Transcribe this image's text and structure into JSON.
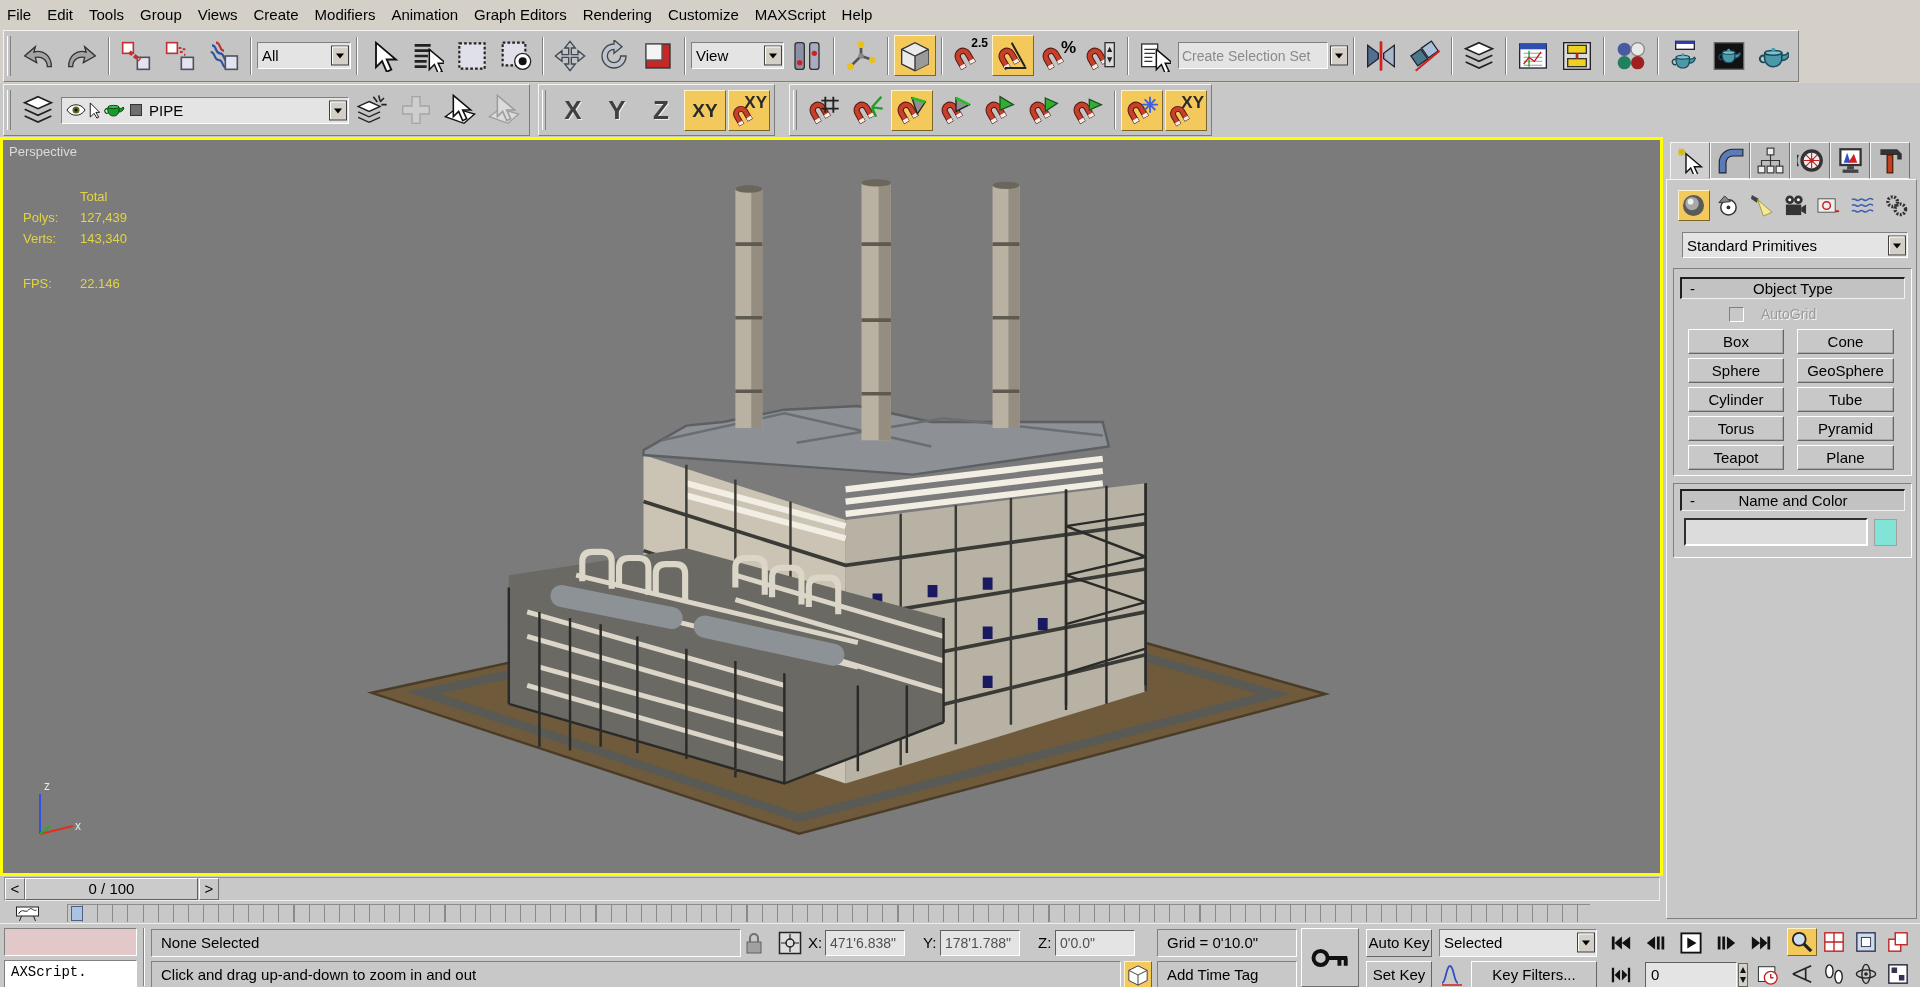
{
  "menu_bar": [
    "File",
    "Edit",
    "Tools",
    "Group",
    "Views",
    "Create",
    "Modifiers",
    "Animation",
    "Graph Editors",
    "Rendering",
    "Customize",
    "MAXScript",
    "Help"
  ],
  "main_toolbar": {
    "groups": [
      [
        {
          "kind": "button",
          "active": false
        },
        {
          "kind": "button",
          "active": false
        }
      ],
      [
        {
          "kind": "button",
          "active": false
        },
        {
          "kind": "button",
          "active": false
        },
        {
          "kind": "button",
          "active": false
        }
      ],
      [
        {
          "kind": "dropdown",
          "value": "All"
        }
      ],
      [
        {
          "kind": "button",
          "active": false
        },
        {
          "kind": "button",
          "active": false
        },
        {
          "kind": "button",
          "active": false
        },
        {
          "kind": "button",
          "active": false
        }
      ],
      [
        {
          "kind": "button",
          "active": false
        },
        {
          "kind": "button",
          "active": false
        },
        {
          "kind": "button",
          "active": false
        }
      ],
      [
        {
          "kind": "dropdown",
          "value": "View"
        },
        {
          "kind": "button",
          "active": false
        }
      ],
      [
        {
          "kind": "button",
          "active": false
        }
      ],
      [
        {
          "kind": "button",
          "active": true
        }
      ],
      [
        {
          "kind": "button",
          "active": false,
          "label": "2.5"
        },
        {
          "kind": "button",
          "active": true
        },
        {
          "kind": "button",
          "active": false,
          "label": "%"
        },
        {
          "kind": "button",
          "active": false
        }
      ],
      [
        {
          "kind": "button",
          "active": false
        },
        {
          "kind": "combo",
          "placeholder": "Create Selection Set"
        }
      ],
      [
        {
          "kind": "button",
          "active": false
        },
        {
          "kind": "button",
          "active": false
        }
      ],
      [
        {
          "kind": "button",
          "active": false
        }
      ],
      [
        {
          "kind": "button",
          "active": false
        },
        {
          "kind": "button",
          "active": false
        }
      ],
      [
        {
          "kind": "button",
          "active": false
        }
      ],
      [
        {
          "kind": "button",
          "active": false
        },
        {
          "kind": "button",
          "active": false
        },
        {
          "kind": "button",
          "active": false
        }
      ]
    ]
  },
  "layers_toolbar": {
    "groups": [
      [
        {
          "kind": "button",
          "active": false,
          "disabled": false
        },
        {
          "kind": "layer_dropdown",
          "value": "PIPE",
          "color": "#6e6e6e",
          "disabled": false
        },
        {
          "kind": "button",
          "active": false,
          "disabled": false
        },
        {
          "kind": "button",
          "active": false,
          "disabled": true
        },
        {
          "kind": "button",
          "active": false,
          "disabled": false
        },
        {
          "kind": "button",
          "active": false,
          "disabled": true
        }
      ]
    ]
  },
  "axis_toolbar": {
    "groups": [
      [
        {
          "kind": "button",
          "active": false,
          "label": "X"
        },
        {
          "kind": "button",
          "active": false,
          "label": "Y"
        },
        {
          "kind": "button",
          "active": false,
          "label": "Z"
        },
        {
          "kind": "button",
          "active": true,
          "label": "XY"
        },
        {
          "kind": "button",
          "active": true,
          "label": "XY"
        }
      ]
    ]
  },
  "snaps_toolbar": {
    "groups": [
      [
        {
          "kind": "button",
          "active": false
        },
        {
          "kind": "button",
          "active": false
        },
        {
          "kind": "button",
          "active": true
        },
        {
          "kind": "button",
          "active": false
        },
        {
          "kind": "button",
          "active": false
        },
        {
          "kind": "button",
          "active": false
        },
        {
          "kind": "button",
          "active": false
        }
      ],
      [
        {
          "kind": "button",
          "active": true
        },
        {
          "kind": "button",
          "active": true,
          "label": "XY"
        }
      ]
    ]
  },
  "viewport": {
    "label": "Perspective",
    "active": true,
    "stats": {
      "header": "Total",
      "rows": [
        {
          "label": "Polys:",
          "value": "127,439"
        },
        {
          "label": "Verts:",
          "value": "143,340"
        }
      ]
    },
    "fps": {
      "label": "FPS:",
      "value": "22.146"
    },
    "axis_labels": [
      "z",
      "x"
    ]
  },
  "command_panel": {
    "tabs": [
      {
        "selected": true
      },
      {
        "selected": false
      },
      {
        "selected": false
      },
      {
        "selected": false
      },
      {
        "selected": false
      },
      {
        "selected": false
      }
    ],
    "categories": [
      {
        "selected": true
      },
      {
        "selected": false
      },
      {
        "selected": false
      },
      {
        "selected": false
      },
      {
        "selected": false
      },
      {
        "selected": false
      },
      {
        "selected": false
      }
    ],
    "dropdown": "Standard Primitives",
    "rollouts": [
      {
        "kind": "object_type",
        "toggle": "-",
        "title": "Object Type",
        "autogrid": {
          "label": "AutoGrid",
          "checked": false,
          "disabled": true
        },
        "buttons": [
          "Box",
          "Cone",
          "Sphere",
          "GeoSphere",
          "Cylinder",
          "Tube",
          "Torus",
          "Pyramid",
          "Teapot",
          "Plane"
        ]
      },
      {
        "kind": "name_color",
        "toggle": "-",
        "title": "Name and Color",
        "color": "#82e4d6"
      }
    ]
  },
  "time_slider": {
    "prev": "<",
    "label": "0 / 100",
    "next": ">",
    "level": 0
  },
  "status_bar": {
    "listener_output": "AXScript.",
    "selection": "None Selected",
    "selection_lock": false,
    "coordinates": [
      {
        "axis": "X:",
        "value": "471'6.838\"",
        "disabled": true
      },
      {
        "axis": "Y:",
        "value": "178'1.788\"",
        "disabled": true
      },
      {
        "axis": "Z:",
        "value": "0'0.0\"",
        "disabled": true
      }
    ],
    "grid": "Grid = 0'10.0\"",
    "auto_key": {
      "label": "Auto Key",
      "on": false
    },
    "key_target": "Selected",
    "navigation": [
      {
        "active": true
      },
      {
        "active": false
      },
      {
        "active": false
      },
      {
        "active": false
      },
      {
        "active": false
      },
      {
        "active": false
      },
      {
        "active": false
      },
      {
        "active": false
      }
    ],
    "prompt": "Click and drag up-and-down to zoom in and out",
    "isolate_toggle": {
      "on": true
    },
    "time_tag": "Add Time Tag",
    "set_key": "Set Key",
    "key_filters": "Key Filters...",
    "frame": "0"
  }
}
